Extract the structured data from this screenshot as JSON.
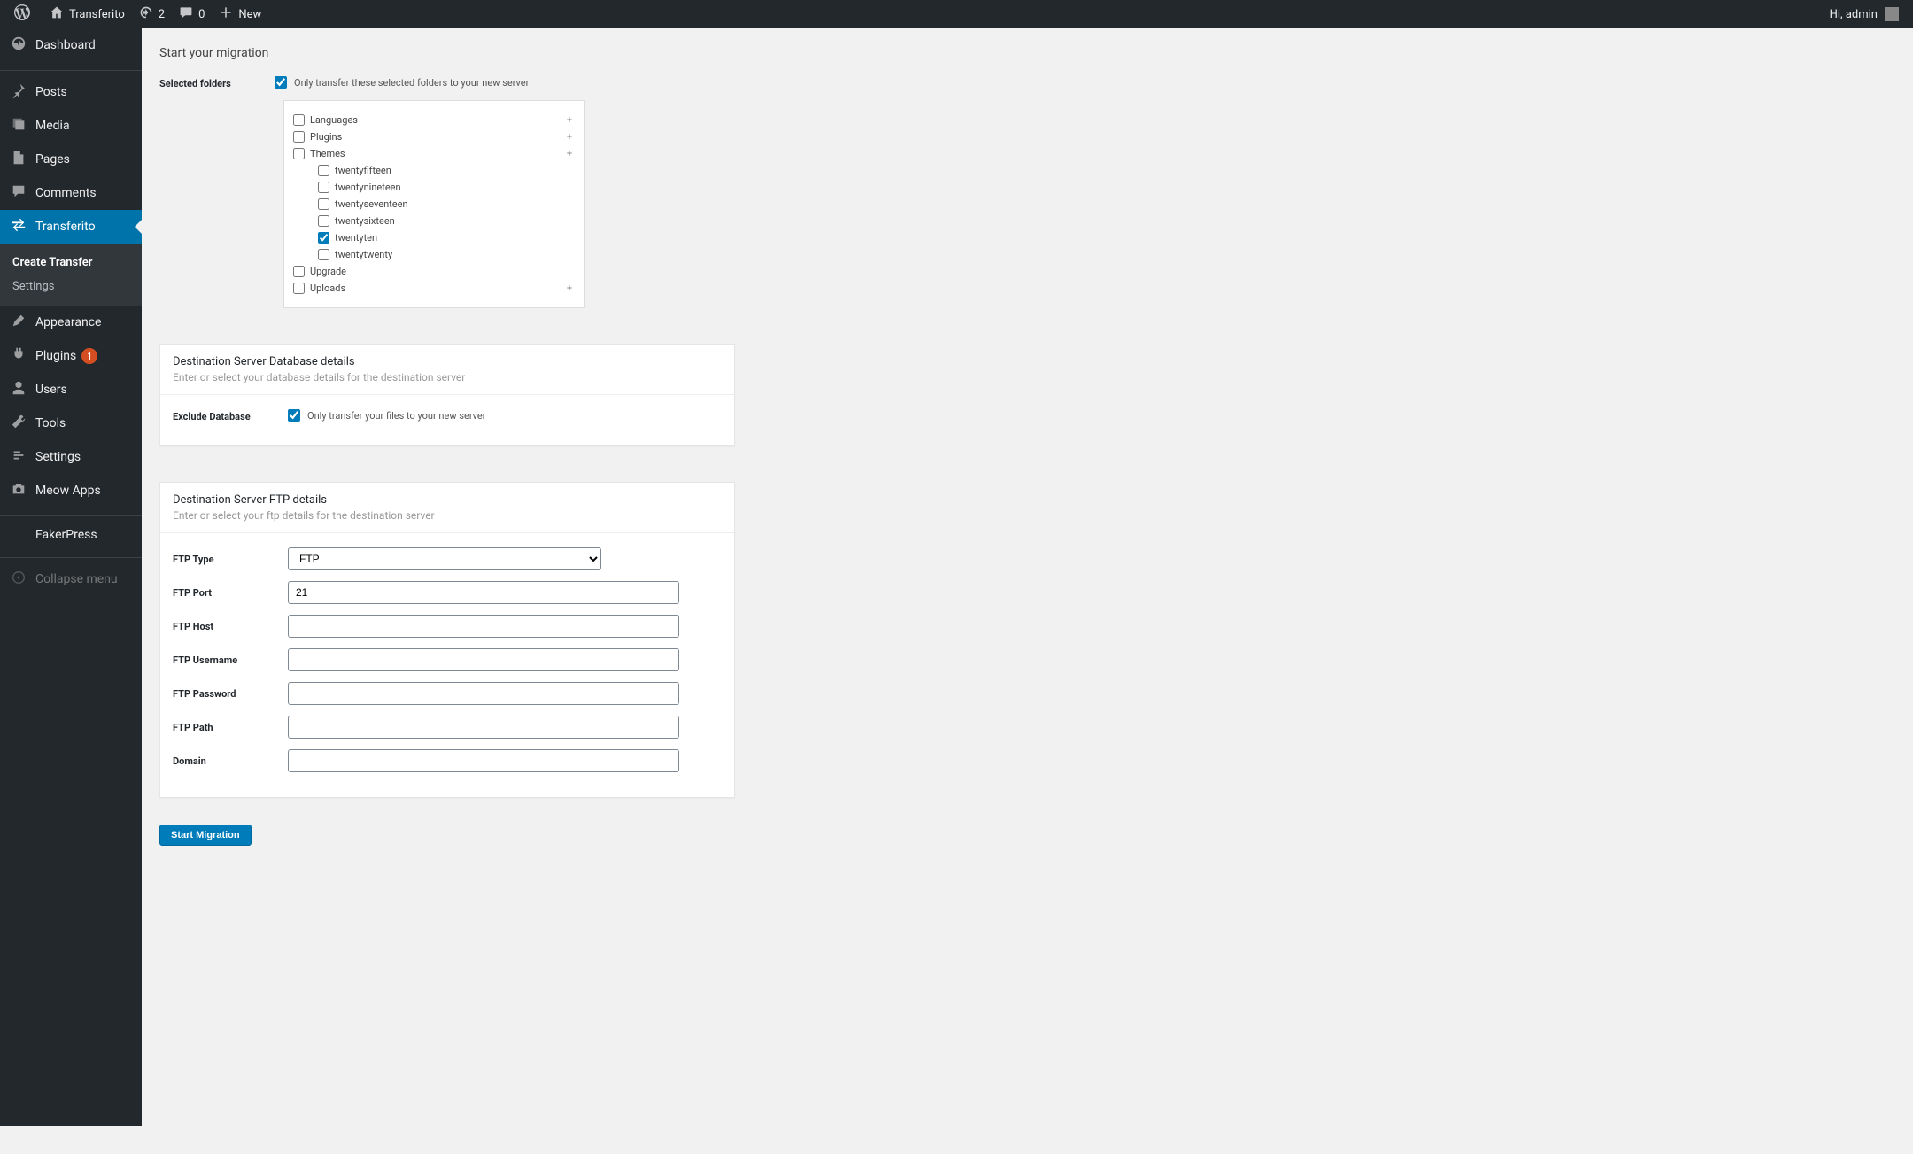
{
  "adminbar": {
    "site_name": "Transferito",
    "updates_count": "2",
    "comments_count": "0",
    "new_label": "New",
    "greeting": "Hi, admin"
  },
  "sidebar": {
    "items": [
      {
        "icon": "dashboard",
        "label": "Dashboard"
      },
      {
        "icon": "posts",
        "label": "Posts"
      },
      {
        "icon": "media",
        "label": "Media"
      },
      {
        "icon": "pages",
        "label": "Pages"
      },
      {
        "icon": "comments",
        "label": "Comments"
      },
      {
        "icon": "transfer",
        "label": "Transferito",
        "current": true
      },
      {
        "icon": "appearance",
        "label": "Appearance"
      },
      {
        "icon": "plugins",
        "label": "Plugins",
        "badge": "1"
      },
      {
        "icon": "users",
        "label": "Users"
      },
      {
        "icon": "tools",
        "label": "Tools"
      },
      {
        "icon": "settings",
        "label": "Settings"
      },
      {
        "icon": "meowapps",
        "label": "Meow Apps"
      },
      {
        "icon": "fakerpress",
        "label": "FakerPress"
      }
    ],
    "submenu": {
      "create_transfer": "Create Transfer",
      "settings": "Settings"
    },
    "collapse_label": "Collapse menu"
  },
  "page": {
    "title": "Start your migration",
    "selected_folders_label": "Selected folders",
    "selected_folders_checkbox_label": "Only transfer these selected folders to your new server",
    "tree": [
      {
        "label": "Languages",
        "checked": false,
        "expandable": true
      },
      {
        "label": "Plugins",
        "checked": false,
        "expandable": true
      },
      {
        "label": "Themes",
        "checked": false,
        "expandable": true,
        "children": [
          {
            "label": "twentyfifteen",
            "checked": false
          },
          {
            "label": "twentynineteen",
            "checked": false
          },
          {
            "label": "twentyseventeen",
            "checked": false
          },
          {
            "label": "twentysixteen",
            "checked": false
          },
          {
            "label": "twentyten",
            "checked": true
          },
          {
            "label": "twentytwenty",
            "checked": false
          }
        ]
      },
      {
        "label": "Upgrade",
        "checked": false,
        "expandable": false
      },
      {
        "label": "Uploads",
        "checked": false,
        "expandable": true
      }
    ],
    "db_panel": {
      "title": "Destination Server Database details",
      "subtitle": "Enter or select your database details for the destination server",
      "exclude_label": "Exclude Database",
      "exclude_checkbox_label": "Only transfer your files to your new server"
    },
    "ftp_panel": {
      "title": "Destination Server FTP details",
      "subtitle": "Enter or select your ftp details for the destination server",
      "fields": {
        "ftp_type_label": "FTP Type",
        "ftp_type_value": "FTP",
        "ftp_port_label": "FTP Port",
        "ftp_port_value": "21",
        "ftp_host_label": "FTP Host",
        "ftp_username_label": "FTP Username",
        "ftp_password_label": "FTP Password",
        "ftp_path_label": "FTP Path",
        "domain_label": "Domain"
      }
    },
    "start_button": "Start Migration"
  }
}
